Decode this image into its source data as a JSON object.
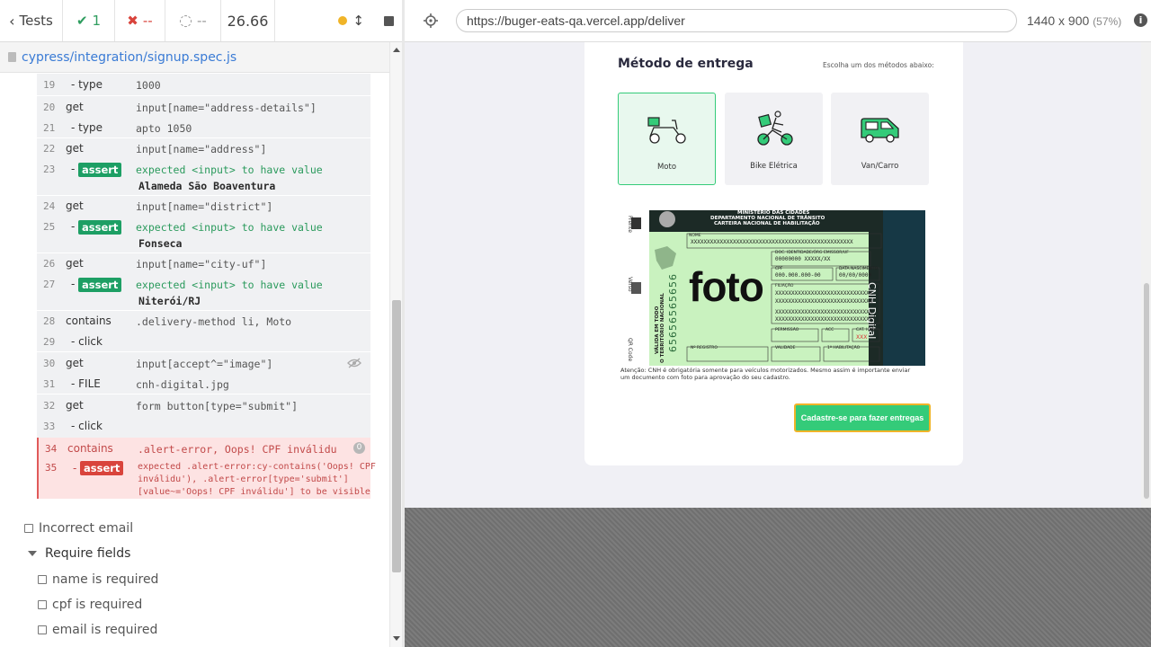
{
  "topbar": {
    "tests_label": "Tests",
    "passed": "1",
    "failed": "--",
    "pending": "--",
    "duration": "26.66"
  },
  "spec": {
    "path": "cypress/integration/signup.spec.js"
  },
  "commands": [
    {
      "n": "19",
      "name": "- type",
      "msg": "1000"
    },
    {
      "n": "20",
      "name": "get",
      "msg": "input[name=\"address-details\"]"
    },
    {
      "n": "21",
      "name": "- type",
      "msg": "apto 1050"
    },
    {
      "n": "22",
      "name": "get",
      "msg": "input[name=\"address\"]"
    },
    {
      "n": "23",
      "name": "-",
      "badge": "assert",
      "msg": "expected  <input>  to have value",
      "sub": "Alameda São Boaventura"
    },
    {
      "n": "24",
      "name": "get",
      "msg": "input[name=\"district\"]"
    },
    {
      "n": "25",
      "name": "-",
      "badge": "assert",
      "msg": "expected  <input>  to have value",
      "sub": "Fonseca"
    },
    {
      "n": "26",
      "name": "get",
      "msg": "input[name=\"city-uf\"]"
    },
    {
      "n": "27",
      "name": "-",
      "badge": "assert",
      "msg": "expected  <input>  to have value",
      "sub": "Niterói/RJ"
    },
    {
      "n": "28",
      "name": "contains",
      "msg": ".delivery-method li, Moto"
    },
    {
      "n": "29",
      "name": "- click",
      "msg": ""
    },
    {
      "n": "30",
      "name": "get",
      "msg": "input[accept^=\"image\"]"
    },
    {
      "n": "31",
      "name": "- FILE",
      "msg": "cnh-digital.jpg"
    },
    {
      "n": "32",
      "name": "get",
      "msg": "form button[type=\"submit\"]"
    },
    {
      "n": "33",
      "name": "- click",
      "msg": ""
    }
  ],
  "error": {
    "n1": "34",
    "name1": "contains",
    "msg1": ".alert-error, Oops! CPF inválidu",
    "count": "0",
    "n2": "35",
    "name2": "-",
    "badge": "assert",
    "line1": "expected  .alert-error:cy-contains('Oops! CPF",
    "line2": "inválidu'), .alert-error[type='submit']",
    "line3": "[value~='Oops! CPF inválidu']  to be  visible"
  },
  "tests": {
    "incorrect_email": "Incorrect email",
    "require_fields": "Require fields",
    "name_required": "name is required",
    "cpf_required": "cpf is required",
    "email_required": "email is required"
  },
  "browser": {
    "url": "https://buger-eats-qa.vercel.app/deliver",
    "viewport": "1440 x 900",
    "scale": "(57%)"
  },
  "app": {
    "section_title": "Método de entrega",
    "choose_hint": "Escolha um dos métodos abaixo:",
    "methods": [
      {
        "label": "Moto",
        "selected": true
      },
      {
        "label": "Bike Elétrica",
        "selected": false
      },
      {
        "label": "Van/Carro",
        "selected": false
      }
    ],
    "cnh": {
      "header1": "MINISTÉRIO DAS CIDADES",
      "header2": "DEPARTAMENTO NACIONAL DE TRÂNSITO",
      "header3": "CARTEIRA NACIONAL DE HABILITAÇÃO",
      "foto": "foto",
      "side": "CNH Digital",
      "nome_label": "NOME",
      "nome_value": "XXXXXXXXXXXXXXXXXXXXXXXXXXXXXXXXXXXXXXXXXXXXXXXXXX",
      "doc_label": "DOC. IDENTIDADE/ÓRG EMISSOR/UF",
      "doc_value": "00000000  XXXXX/XX",
      "cpf_label": "CPF",
      "cpf_value": "000.000.000-00",
      "nasc_label": "DATA NASCIMENTO",
      "nasc_value": "00/00/0000",
      "filiacao_label": "FILIAÇÃO",
      "filiacao_line": "XXXXXXXXXXXXXXXXXXXXXXXXXXXXXX",
      "permissao_label": "PERMISSÃO",
      "acc_label": "ACC",
      "cat_label": "CAT. HAB.",
      "cat_value": "XXX",
      "registro_label": "Nº REGISTRO",
      "validade_label": "VALIDADE",
      "habilitacao_label": "1ª HABILITAÇÃO",
      "vertical_number": "65656565656",
      "vertical_text1": "VÁLIDA EM TODO",
      "vertical_text2": "O TERRITÓRIO NACIONAL",
      "frente": "Frente",
      "verso": "Verso",
      "qr": "QR Code"
    },
    "notice": "Atenção: CNH é obrigatória somente para veículos motorizados. Mesmo assim é importante enviar um documento com foto para aprovação do seu cadastro.",
    "submit_label": "Cadastre-se para fazer entregas"
  },
  "colors": {
    "accent": "#34cb79",
    "fail": "#d9443c",
    "link": "#3a7bd5",
    "highlight": "#f0b428"
  }
}
